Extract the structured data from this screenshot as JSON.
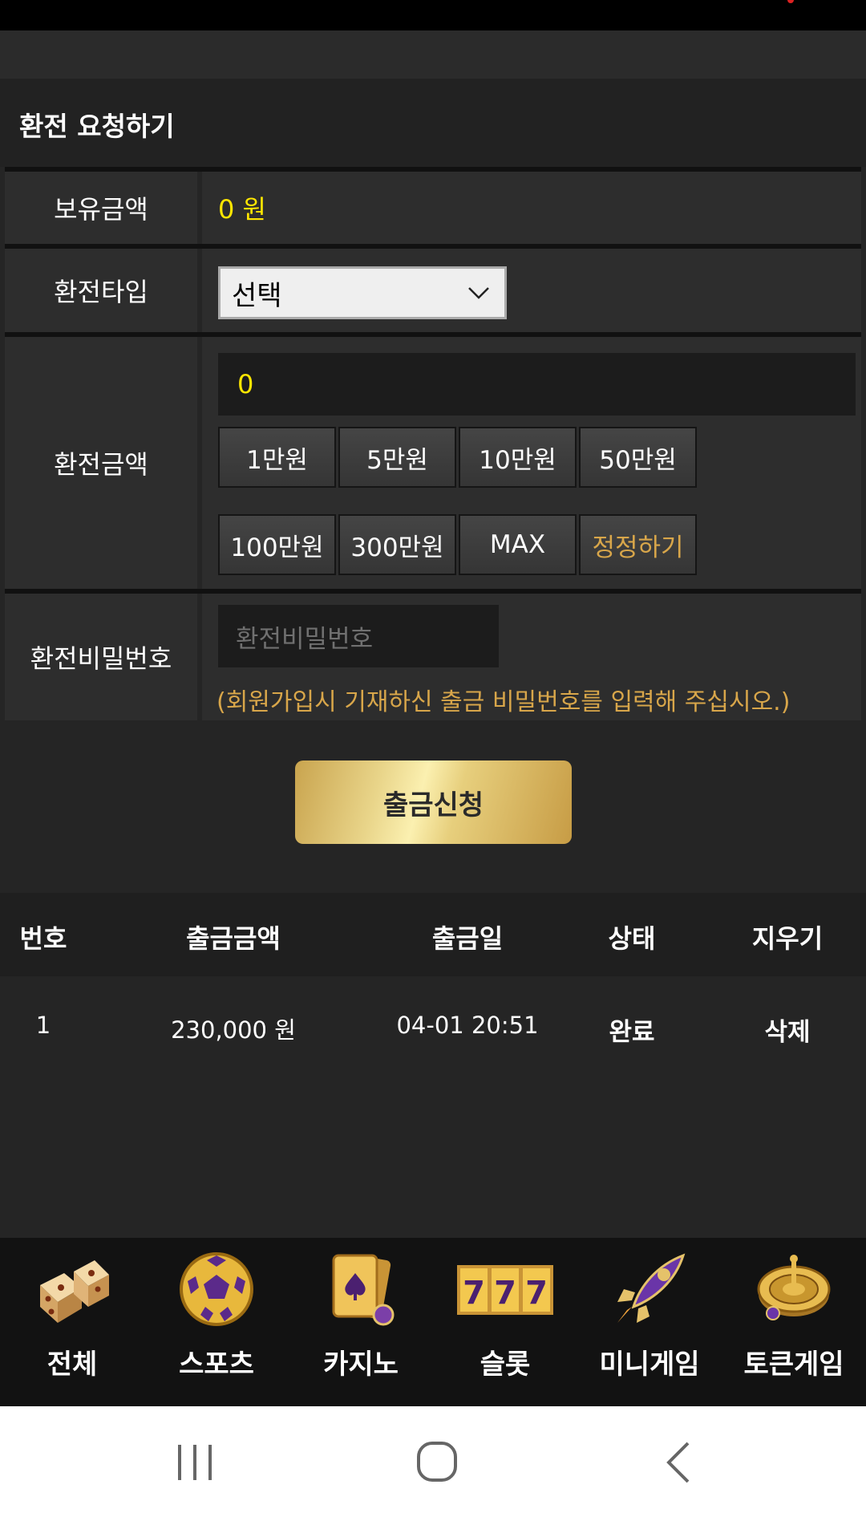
{
  "section": {
    "title": "환전 요청하기"
  },
  "form": {
    "balance_label": "보유금액",
    "balance_value": "0 원",
    "type_label": "환전타입",
    "type_selected": "선택",
    "amount_label": "환전금액",
    "amount_value": "0",
    "amount_buttons": [
      "1만원",
      "5만원",
      "10만원",
      "50만원",
      "100만원",
      "300만원",
      "MAX",
      "정정하기"
    ],
    "password_label": "환전비밀번호",
    "password_placeholder": "환전비밀번호",
    "password_hint": "(회원가입시 기재하신 출금 비밀번호를 입력해 주십시오.)",
    "submit_label": "출금신청"
  },
  "table": {
    "headers": [
      "번호",
      "출금금액",
      "출금일",
      "상태",
      "지우기"
    ],
    "rows": [
      {
        "no": "1",
        "amount": "230,000 원",
        "date": "04-01 20:51",
        "status": "완료",
        "delete": "삭제"
      }
    ]
  },
  "bottom_nav": [
    {
      "label": "전체",
      "icon": "dice-icon"
    },
    {
      "label": "스포츠",
      "icon": "soccer-ball-icon"
    },
    {
      "label": "카지노",
      "icon": "playing-cards-icon"
    },
    {
      "label": "슬롯",
      "icon": "slot-777-icon"
    },
    {
      "label": "미니게임",
      "icon": "rocket-icon"
    },
    {
      "label": "토큰게임",
      "icon": "roulette-icon"
    }
  ],
  "colors": {
    "accent_yellow": "#ffe600",
    "accent_gold": "#d8a64a",
    "background": "#252525"
  }
}
